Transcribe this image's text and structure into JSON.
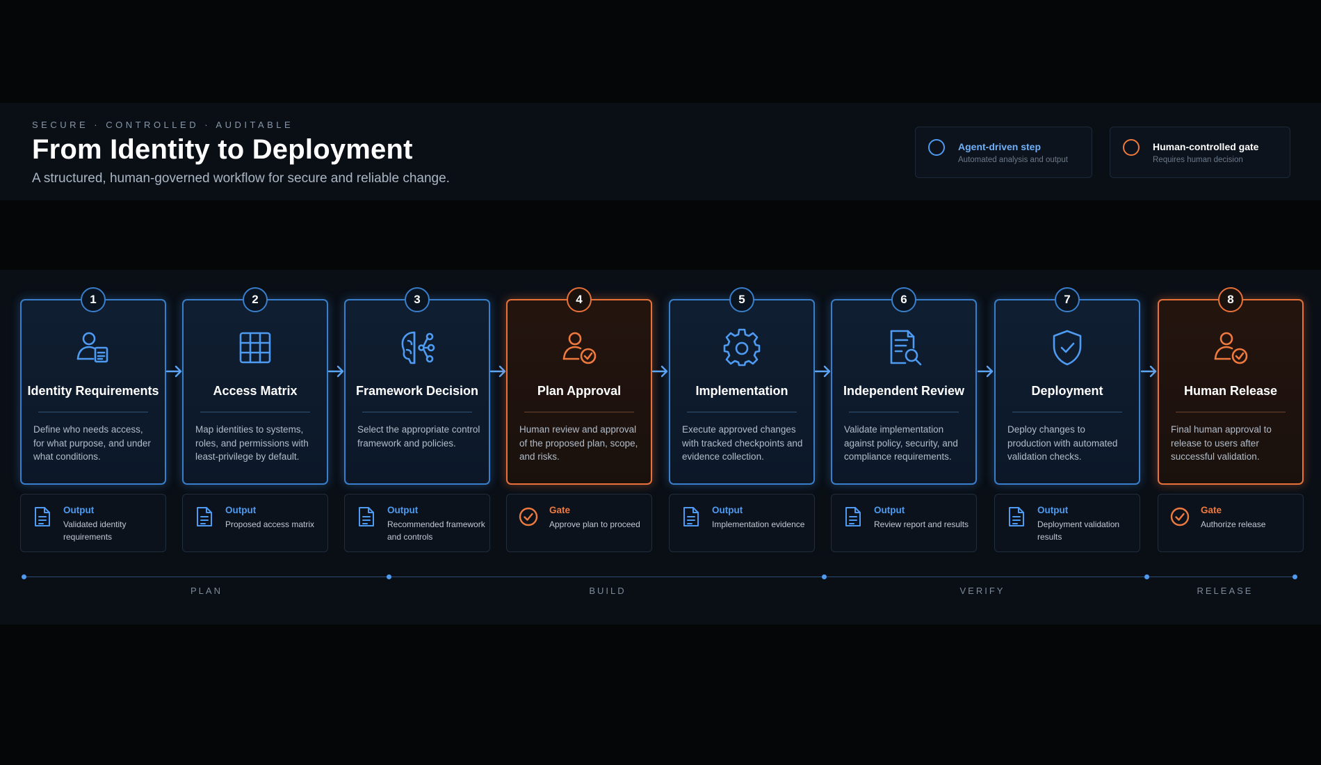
{
  "header": {
    "tagline": "SECURE  ·  CONTROLLED  ·  AUDITABLE",
    "title": "From Identity to Deployment",
    "subtitle": "A structured, human-governed workflow for secure and reliable change."
  },
  "legend": {
    "agent": {
      "title": "Agent-driven step",
      "desc": "Automated analysis and output",
      "color": "#4f9bf2"
    },
    "human": {
      "title": "Human-controlled gate",
      "desc": "Requires human decision",
      "color": "#ef7a3f"
    }
  },
  "steps": [
    {
      "num": "1",
      "kind": "agent",
      "icon": "user-document-icon",
      "title": "Identity Requirements",
      "desc": "Define who needs access, for what purpose, and under what conditions.",
      "out_label": "Output",
      "out_text": "Validated identity requirements"
    },
    {
      "num": "2",
      "kind": "agent",
      "icon": "grid-icon",
      "title": "Access Matrix",
      "desc": "Map identities to systems, roles, and permissions with least-privilege by default.",
      "out_label": "Output",
      "out_text": "Proposed access matrix"
    },
    {
      "num": "3",
      "kind": "agent",
      "icon": "network-icon",
      "title": "Framework Decision",
      "desc": "Select the appropriate control framework and policies.",
      "out_label": "Output",
      "out_text": "Recommended framework and controls"
    },
    {
      "num": "4",
      "kind": "gate",
      "icon": "user-check-icon",
      "title": "Plan Approval",
      "desc": "Human review and approval of the proposed plan, scope, and risks.",
      "out_label": "Gate",
      "out_text": "Approve plan to proceed"
    },
    {
      "num": "5",
      "kind": "agent",
      "icon": "gear-icon",
      "title": "Implementation",
      "desc": "Execute approved changes with tracked checkpoints and evidence collection.",
      "out_label": "Output",
      "out_text": "Implementation evidence"
    },
    {
      "num": "6",
      "kind": "agent",
      "icon": "document-search-icon",
      "title": "Independent Review",
      "desc": "Validate implementation against policy, security, and compliance requirements.",
      "out_label": "Output",
      "out_text": "Review report and results"
    },
    {
      "num": "7",
      "kind": "agent",
      "icon": "shield-check-icon",
      "title": "Deployment",
      "desc": "Deploy changes to production with automated validation checks.",
      "out_label": "Output",
      "out_text": "Deployment validation results"
    },
    {
      "num": "8",
      "kind": "gate",
      "icon": "user-check-icon",
      "title": "Human Release",
      "desc": "Final human approval to release to users after successful validation.",
      "out_label": "Gate",
      "out_text": "Authorize release"
    }
  ],
  "phases": [
    "PLAN",
    "BUILD",
    "VERIFY",
    "RELEASE"
  ]
}
